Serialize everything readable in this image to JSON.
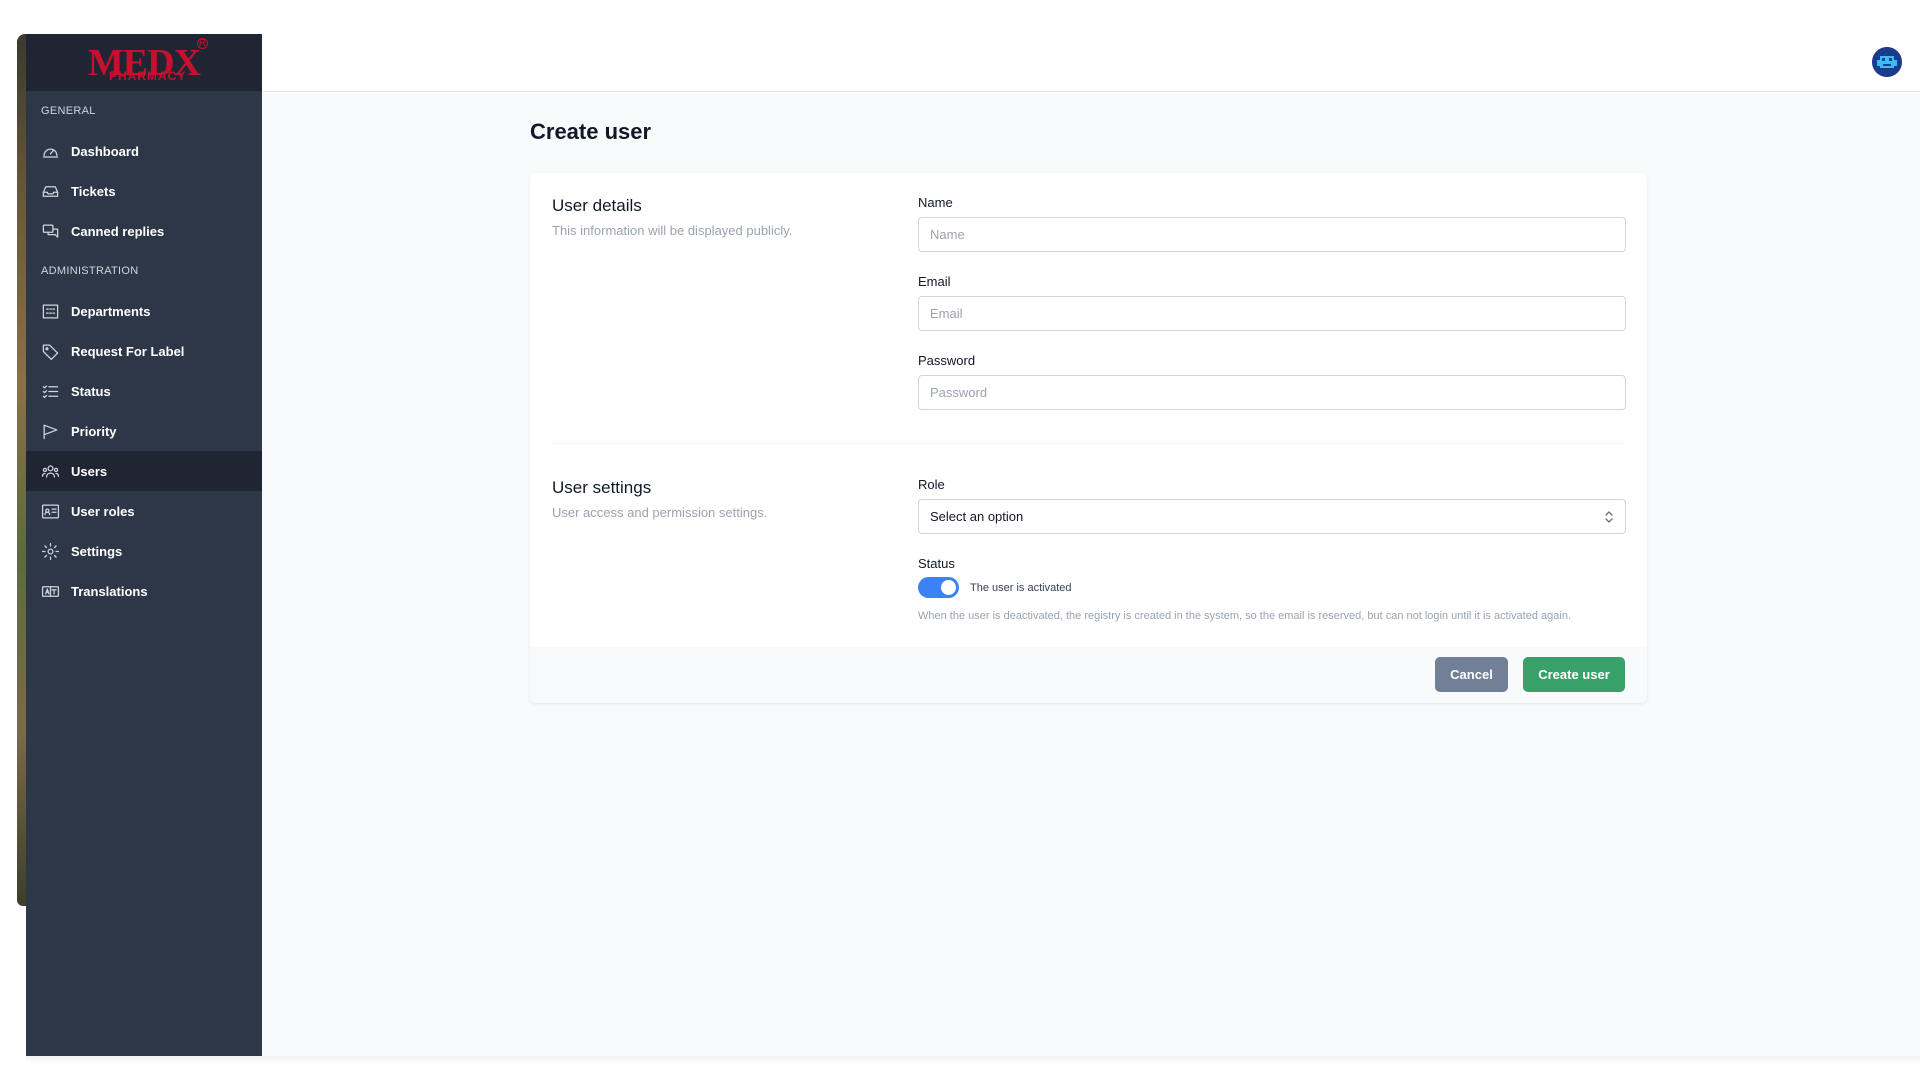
{
  "brand": {
    "logo_text": "MEDX",
    "logo_sub": "PHARMACY",
    "logo_reg": "R"
  },
  "sidebar": {
    "general_heading": "General",
    "admin_heading": "Administration",
    "general_items": [
      {
        "label": "Dashboard",
        "icon": "dashboard-gauge-icon"
      },
      {
        "label": "Tickets",
        "icon": "inbox-tray-icon"
      },
      {
        "label": "Canned replies",
        "icon": "chat-bubbles-icon"
      }
    ],
    "admin_items": [
      {
        "label": "Departments",
        "icon": "office-building-icon"
      },
      {
        "label": "Request For Label",
        "icon": "tag-icon"
      },
      {
        "label": "Status",
        "icon": "checklist-icon"
      },
      {
        "label": "Priority",
        "icon": "flag-icon"
      },
      {
        "label": "Users",
        "icon": "users-icon",
        "active": true
      },
      {
        "label": "User roles",
        "icon": "id-card-icon"
      },
      {
        "label": "Settings",
        "icon": "gear-icon"
      },
      {
        "label": "Translations",
        "icon": "language-icon"
      }
    ]
  },
  "page": {
    "title": "Create user"
  },
  "user_details": {
    "title": "User details",
    "description": "This information will be displayed publicly.",
    "name_label": "Name",
    "name_placeholder": "Name",
    "email_label": "Email",
    "email_placeholder": "Email",
    "password_label": "Password",
    "password_placeholder": "Password"
  },
  "user_settings": {
    "title": "User settings",
    "description": "User access and permission settings.",
    "role_label": "Role",
    "role_value": "Select an option",
    "status_label": "Status",
    "status_toggle_text": "The user is activated",
    "status_on": true,
    "status_help": "When the user is deactivated, the registry is created in the system, so the email is reserved, but can not login until it is activated again."
  },
  "actions": {
    "cancel_label": "Cancel",
    "create_label": "Create user"
  },
  "colors": {
    "sidebar_bg": "#2d3748",
    "accent_blue": "#3b82f6",
    "create_green": "#38a169",
    "cancel_gray": "#718096",
    "brand_red": "#c8102e"
  }
}
